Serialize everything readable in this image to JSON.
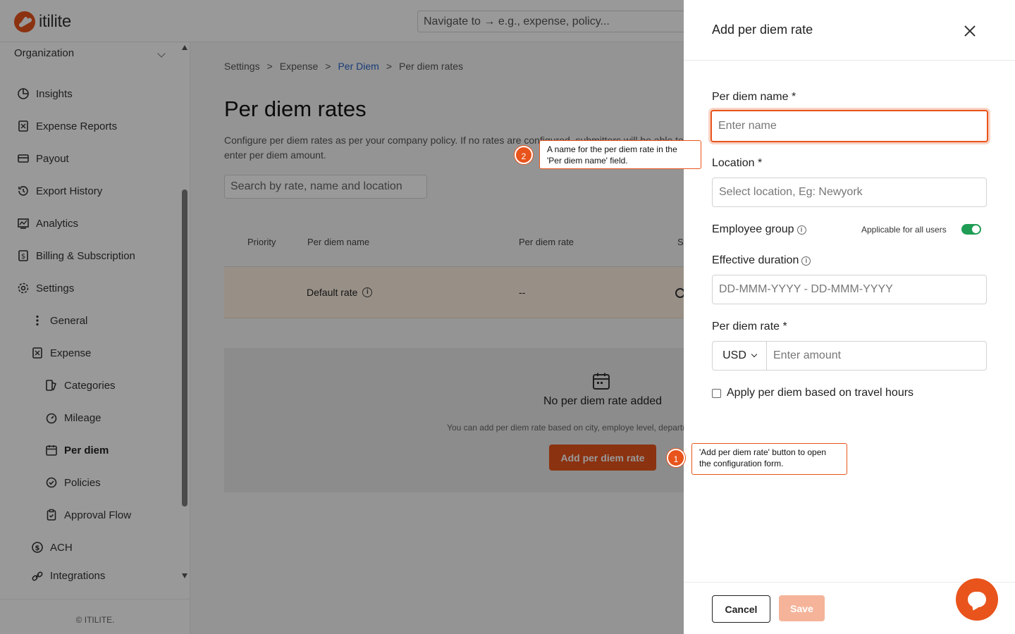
{
  "app": {
    "logo_text": "itilite"
  },
  "topbar": {
    "nav_placeholder": "Navigate to → e.g., expense, policy..."
  },
  "sidebar": {
    "org_label": "Organization",
    "items": [
      {
        "label": "Insights",
        "icon": "pie-chart-icon"
      },
      {
        "label": "Expense Reports",
        "icon": "receipt-icon"
      },
      {
        "label": "Payout",
        "icon": "card-icon"
      },
      {
        "label": "Export History",
        "icon": "history-icon"
      },
      {
        "label": "Analytics",
        "icon": "analytics-icon"
      },
      {
        "label": "Billing & Subscription",
        "icon": "billing-icon"
      },
      {
        "label": "Settings",
        "icon": "gear-icon"
      },
      {
        "label": "General",
        "icon": "more-vertical-icon"
      },
      {
        "label": "Expense",
        "icon": "receipt-icon"
      },
      {
        "label": "Categories",
        "icon": "categories-icon"
      },
      {
        "label": "Mileage",
        "icon": "gauge-icon"
      },
      {
        "label": "Per diem",
        "icon": "calendar-icon"
      },
      {
        "label": "Policies",
        "icon": "check-circle-icon"
      },
      {
        "label": "Approval Flow",
        "icon": "clipboard-check-icon"
      },
      {
        "label": "ACH",
        "icon": "dollar-circle-icon"
      },
      {
        "label": "Integrations",
        "icon": "link-icon"
      }
    ],
    "footer": "© ITILITE."
  },
  "main": {
    "breadcrumb": [
      "Settings",
      ">",
      "Expense",
      ">",
      "Per Diem",
      ">",
      "Per diem rates"
    ],
    "title": "Per diem rates",
    "description": "Configure per diem rates as per your company policy. If no rates are configured, submitters will be able to enter per diem amount.",
    "search_placeholder": "Search by rate, name and location",
    "table": {
      "headers": [
        "Priority",
        "Per diem name",
        "Per diem rate",
        "St"
      ],
      "row": {
        "name": "Default rate",
        "rate": "--"
      }
    },
    "empty": {
      "title": "No per diem rate added",
      "description": "You can add per diem rate based on city, employe level, department",
      "button": "Add per diem rate"
    }
  },
  "drawer": {
    "title": "Add per diem rate",
    "name_label": "Per diem name *",
    "name_placeholder": "Enter name",
    "location_label": "Location *",
    "location_placeholder": "Select location, Eg: Newyork",
    "group_label": "Employee group",
    "applicable_label": "Applicable for all users",
    "duration_label": "Effective duration",
    "duration_placeholder": "DD-MMM-YYYY - DD-MMM-YYYY",
    "rate_label": "Per diem rate *",
    "currency": "USD",
    "amount_placeholder": "Enter amount",
    "travel_hours_label": "Apply per diem based on travel hours",
    "cancel": "Cancel",
    "save": "Save"
  },
  "annotations": [
    {
      "num": "1",
      "text": "'Add per diem rate' button to open the configuration form."
    },
    {
      "num": "2",
      "text": "A name for the per diem rate in the 'Per diem name' field."
    }
  ],
  "colors": {
    "accent": "#e8541c",
    "toggle_on": "#1f9d55",
    "link": "#2a64c8"
  }
}
